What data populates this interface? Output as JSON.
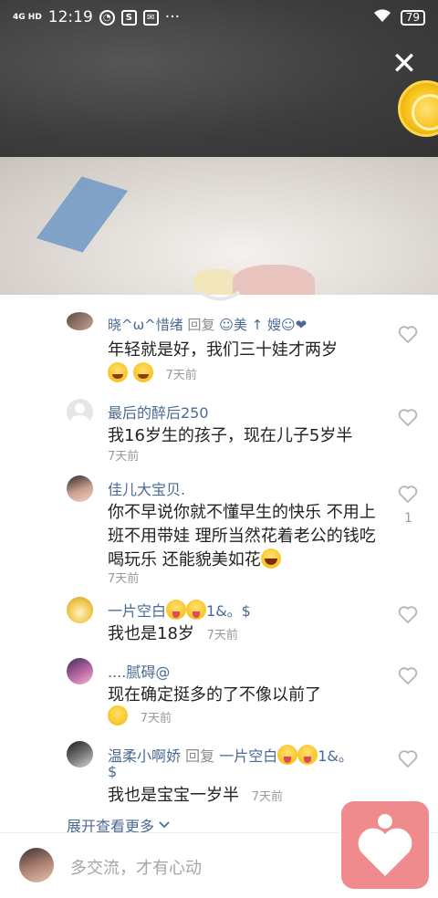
{
  "status_bar": {
    "network": "4G HD",
    "time": "12:19",
    "battery": "79"
  },
  "video": {
    "close_icon": "close-icon",
    "coin_icon": "gold-coin-icon"
  },
  "comments": [
    {
      "name": "晓^ω^惜绪",
      "reply_word": "回复",
      "reply_to": "☺美 ↑ 嫂☺❤",
      "text": "年轻就是好，我们三十娃才两岁",
      "emojis": [
        "cry",
        "cry"
      ],
      "time": "7天前"
    },
    {
      "name": "最后的醉后250",
      "text": "我16岁生的孩子，现在儿子5岁半",
      "time": "7天前"
    },
    {
      "name": "佳儿大宝贝.",
      "text": "你不早说你就不懂早生的快乐 不用上班不用带娃 理所当然花着老公的钱吃喝玩乐 还能貌美如花",
      "emojis": [
        "laugh"
      ],
      "time": "7天前",
      "likes": "1"
    },
    {
      "name": "一片空白",
      "name_suffix": "1&。$",
      "name_emojis": [
        "tongue",
        "tongue"
      ],
      "text": "我也是18岁",
      "time": "7天前"
    },
    {
      "name": "....腻碍@",
      "text": "现在确定挺多的了不像以前了",
      "emojis": [
        "smile"
      ],
      "time": "7天前"
    },
    {
      "name": "温柔小啊娇",
      "reply_word": "回复",
      "reply_to": "一片空白",
      "reply_suffix": "1&。",
      "reply_line2": "$",
      "text": "我也是宝宝一岁半",
      "time": "7天前"
    }
  ],
  "expand_label": "展开查看更多",
  "input": {
    "placeholder": "多交流，才有心动"
  }
}
